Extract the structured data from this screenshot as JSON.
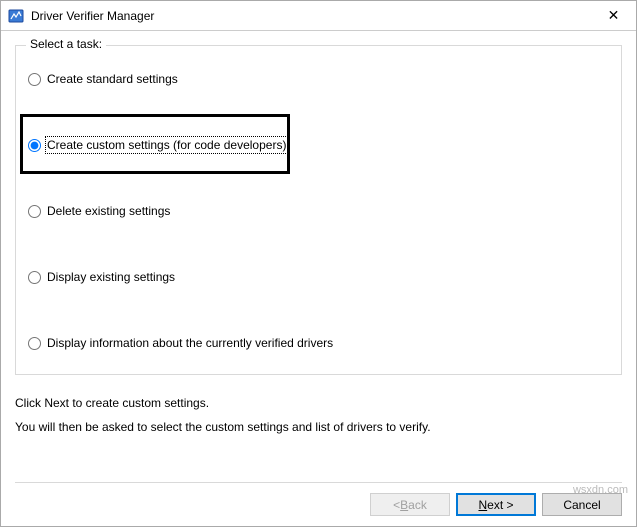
{
  "window": {
    "title": "Driver Verifier Manager",
    "close_glyph": "✕"
  },
  "group": {
    "label": "Select a task:"
  },
  "options": [
    {
      "label": "Create standard settings"
    },
    {
      "label": "Create custom settings (for code developers)"
    },
    {
      "label": "Delete existing settings"
    },
    {
      "label": "Display existing settings"
    },
    {
      "label": "Display information about the currently verified drivers"
    }
  ],
  "selected_index": 1,
  "info": {
    "line1": "Click Next to create custom settings.",
    "line2": "You will then be asked to select the custom settings and list of drivers to verify."
  },
  "buttons": {
    "back_prefix": "< ",
    "back_mn": "B",
    "back_suffix": "ack",
    "next_mn": "N",
    "next_suffix": "ext >",
    "cancel": "Cancel"
  },
  "watermark": "wsxdn.com"
}
